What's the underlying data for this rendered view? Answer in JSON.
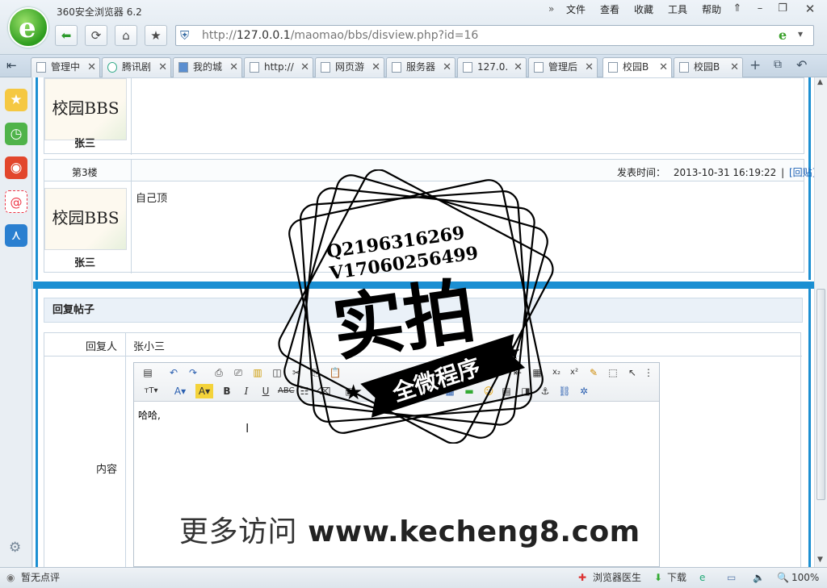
{
  "window": {
    "app_title": "360安全浏览器 6.2",
    "menu": [
      "文件",
      "查看",
      "收藏",
      "工具",
      "帮助"
    ]
  },
  "address_bar": {
    "url_prefix": "http://",
    "url_host": "127.0.0.1",
    "url_path": "/maomao/bbs/disview.php?id=16"
  },
  "tabs": [
    "管理中",
    "腾讯剧",
    "我的城",
    "http://",
    "网页游",
    "服务器",
    "127.0.",
    "管理后",
    "校园B",
    "校园B"
  ],
  "active_tab_index": 8,
  "posts": [
    {
      "avatar_text": "校园BBS",
      "username": "张三"
    },
    {
      "floor": "第3楼",
      "time_label": "发表时间：",
      "time": "2013-10-31 16:19:22",
      "reply_link": "[回贴]",
      "body": "自己顶",
      "avatar_text": "校园BBS",
      "username": "张三"
    }
  ],
  "reply": {
    "title": "回复帖子",
    "replier_label": "回复人",
    "replier_value": "张小三",
    "content_label": "内容",
    "content_value": "哈哈,"
  },
  "status_bar": {
    "rating": "暂无点评",
    "doctor": "浏览器医生",
    "download": "下载",
    "zoom": "100%"
  },
  "watermark": {
    "line1": "Q2196316269",
    "line2": "V17060256499",
    "big": "实拍",
    "banner": "全微程序",
    "url_prefix": "更多访问",
    "url": "www.kecheng8.com"
  }
}
